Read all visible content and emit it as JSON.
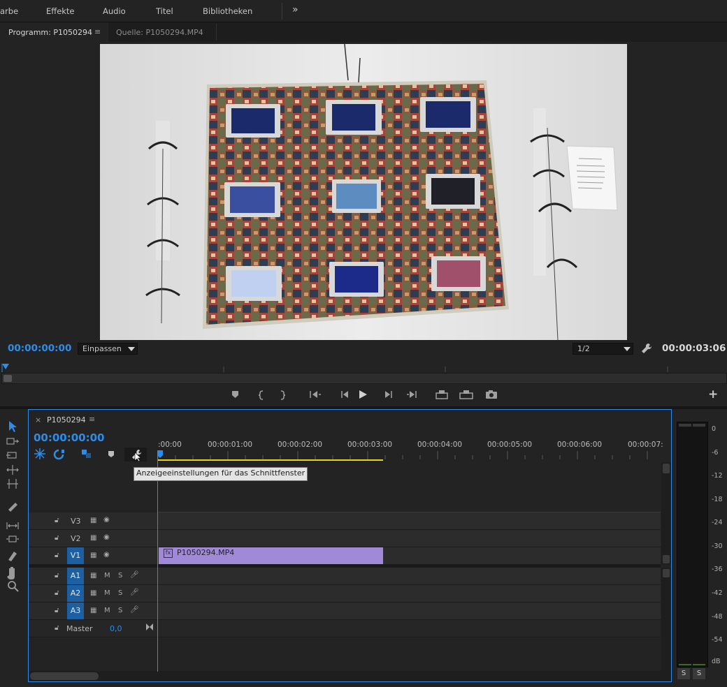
{
  "menubar": {
    "items": [
      "arbe",
      "Effekte",
      "Audio",
      "Titel",
      "Bibliotheken"
    ],
    "overflow": "»"
  },
  "monitor": {
    "tabs": [
      {
        "label": "Programm: P1050294",
        "menu": "≡"
      },
      {
        "label": "Quelle: P1050294.MP4"
      }
    ],
    "current_time": "00:00:00:00",
    "zoom": "Einpassen",
    "resolution": "1/2",
    "duration": "00:00:03:06",
    "transport_icons": [
      "marker-icon",
      "in-point-icon",
      "out-point-icon",
      "go-to-in-icon",
      "step-back-icon",
      "play-icon",
      "step-forward-icon",
      "go-to-out-icon",
      "lift-icon",
      "extract-icon",
      "export-frame-icon"
    ],
    "add_button": "+"
  },
  "timeline": {
    "close": "×",
    "sequence_name": "P1050294",
    "menu": "≡",
    "timecode": "00:00:00:00",
    "ruler_labels": [
      ":00:00",
      "00:00:01:00",
      "00:00:02:00",
      "00:00:03:00",
      "00:00:04:00",
      "00:00:05:00",
      "00:00:06:00",
      "00:00:07:"
    ],
    "tooltip": "Anzeigeeinstellungen für das Schnittfenster",
    "video_tracks": [
      "V3",
      "V2",
      "V1"
    ],
    "audio_tracks": [
      {
        "name": "A1",
        "m": "M",
        "s": "S"
      },
      {
        "name": "A2",
        "m": "M",
        "s": "S"
      },
      {
        "name": "A3",
        "m": "M",
        "s": "S"
      }
    ],
    "master": {
      "label": "Master",
      "value": "0,0"
    },
    "clip": {
      "fx": "fx",
      "name": "P1050294.MP4"
    }
  },
  "meters": {
    "db_labels": [
      "0",
      "-6",
      "-12",
      "-18",
      "-24",
      "-30",
      "-36",
      "-42",
      "-48",
      "-54",
      "dB"
    ],
    "solo": [
      "S",
      "S"
    ]
  },
  "colors": {
    "accent": "#2d8ceb",
    "clip": "#a08ad8",
    "work_area": "#e8d700",
    "target": "#1d5fa3"
  }
}
